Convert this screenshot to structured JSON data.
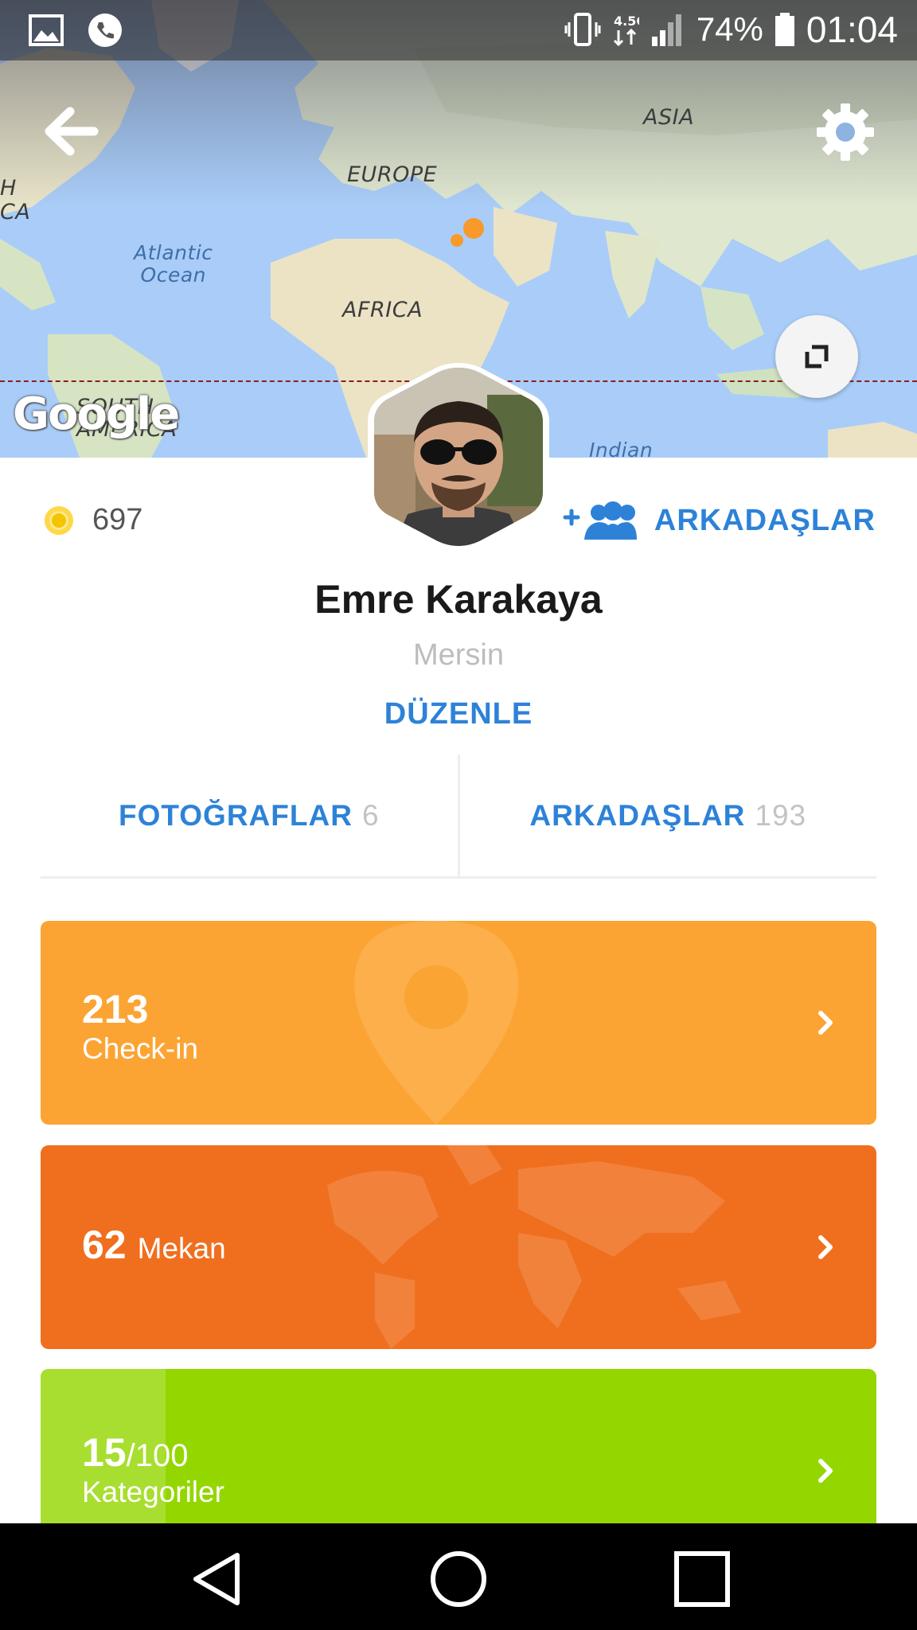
{
  "status_bar": {
    "battery": "74%",
    "time": "01:04",
    "network": "4.5G"
  },
  "map": {
    "labels": {
      "asia": "ASIA",
      "europe": "EUROPE",
      "africa": "AFRICA",
      "atlantic": "Atlantic\nOcean",
      "south_america": "SOUTH\nAMERICA",
      "indian": "Indian",
      "north_america_partial": "H\nCA"
    },
    "logo": "Google"
  },
  "profile": {
    "coins": "697",
    "friends_link": "ARKADAŞLAR",
    "name": "Emre Karakaya",
    "city": "Mersin",
    "edit": "DÜZENLE"
  },
  "tabs": [
    {
      "label": "FOTOĞRAFLAR",
      "count": "6"
    },
    {
      "label": "ARKADAŞLAR",
      "count": "193"
    }
  ],
  "stats": {
    "checkin": {
      "value": "213",
      "label": "Check-in"
    },
    "venues": {
      "value": "62",
      "label": "Mekan"
    },
    "categories": {
      "value": "15",
      "total": "/100",
      "label": "Kategoriler"
    }
  },
  "colors": {
    "accent_blue": "#2d82d8",
    "checkin_orange": "#fca433",
    "venues_orange": "#f06f1f",
    "categories_green": "#94d600"
  },
  "icons": [
    "back-arrow-icon",
    "gear-icon",
    "expand-icon",
    "coin-icon",
    "add-friends-icon",
    "chevron-right-icon",
    "nav-back-icon",
    "nav-home-icon",
    "nav-recents-icon"
  ]
}
